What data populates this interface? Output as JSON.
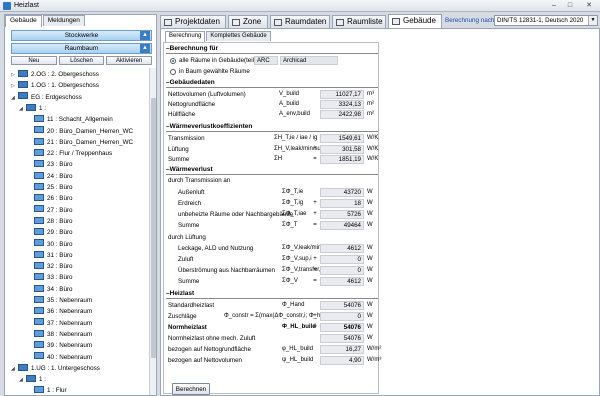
{
  "window": {
    "title": "Heizlast",
    "minimize": "–",
    "maximize": "□",
    "close": "✕"
  },
  "left": {
    "tabs": [
      "Gebäude",
      "Meldungen"
    ],
    "buttons": {
      "stockwerke": "Stockwerke",
      "raumbaum": "Raumbaum",
      "neu": "Neu",
      "loeschen": "Löschen",
      "aktivieren": "Aktivieren"
    },
    "tree": [
      {
        "label": "2.OG : 2. Obergeschoss",
        "tri": "▷",
        "level": 1,
        "type": "floor"
      },
      {
        "label": "1.OG : 1. Obergeschoss",
        "tri": "▷",
        "level": 1,
        "type": "floor"
      },
      {
        "label": "EG : Erdgeschoss",
        "tri": "◢",
        "level": 1,
        "type": "floor"
      },
      {
        "label": "1 :",
        "tri": "◢",
        "level": 2,
        "type": "floor"
      },
      {
        "label": "11 : Schacht_Allgemein",
        "tri": "",
        "level": 3,
        "type": "room"
      },
      {
        "label": "20 : Büro_Damen_Herren_WC",
        "tri": "",
        "level": 3,
        "type": "room"
      },
      {
        "label": "21 : Büro_Damen_Herren_WC",
        "tri": "",
        "level": 3,
        "type": "room"
      },
      {
        "label": "22 : Flur / Treppenhaus",
        "tri": "",
        "level": 3,
        "type": "room"
      },
      {
        "label": "23 : Büro",
        "tri": "",
        "level": 3,
        "type": "room"
      },
      {
        "label": "24 : Büro",
        "tri": "",
        "level": 3,
        "type": "room"
      },
      {
        "label": "25 : Büro",
        "tri": "",
        "level": 3,
        "type": "room"
      },
      {
        "label": "26 : Büro",
        "tri": "",
        "level": 3,
        "type": "room"
      },
      {
        "label": "27 : Büro",
        "tri": "",
        "level": 3,
        "type": "room"
      },
      {
        "label": "28 : Büro",
        "tri": "",
        "level": 3,
        "type": "room"
      },
      {
        "label": "29 : Büro",
        "tri": "",
        "level": 3,
        "type": "room"
      },
      {
        "label": "30 : Büro",
        "tri": "",
        "level": 3,
        "type": "room"
      },
      {
        "label": "31 : Büro",
        "tri": "",
        "level": 3,
        "type": "room"
      },
      {
        "label": "32 : Büro",
        "tri": "",
        "level": 3,
        "type": "room"
      },
      {
        "label": "33 : Büro",
        "tri": "",
        "level": 3,
        "type": "room"
      },
      {
        "label": "34 : Büro",
        "tri": "",
        "level": 3,
        "type": "room"
      },
      {
        "label": "35 : Nebenraum",
        "tri": "",
        "level": 3,
        "type": "room"
      },
      {
        "label": "36 : Nebenraum",
        "tri": "",
        "level": 3,
        "type": "room"
      },
      {
        "label": "37 : Nebenraum",
        "tri": "",
        "level": 3,
        "type": "room"
      },
      {
        "label": "38 : Nebenraum",
        "tri": "",
        "level": 3,
        "type": "room"
      },
      {
        "label": "39 : Nebenraum",
        "tri": "",
        "level": 3,
        "type": "room"
      },
      {
        "label": "40 : Nebenraum",
        "tri": "",
        "level": 3,
        "type": "room"
      },
      {
        "label": "1.UG : 1. Untergeschoss",
        "tri": "◢",
        "level": 1,
        "type": "floor"
      },
      {
        "label": "1 :",
        "tri": "◢",
        "level": 2,
        "type": "floor"
      },
      {
        "label": "1 : Flur",
        "tri": "",
        "level": 3,
        "type": "room"
      }
    ]
  },
  "main_tabs": [
    "Projektdaten",
    "Zone",
    "Raumdaten",
    "Raumliste",
    "Gebäude"
  ],
  "berechnung_label": "Berechnung nach",
  "berechnung_value": "DIN/TS 12831-1, Deutsch 2020",
  "sub_tabs": [
    "Berechnung",
    "Komplettes Gebäude"
  ],
  "sections": {
    "berechnung_fuer": "Berechnung für",
    "gebaeudedaten": "Gebäudedaten",
    "waermeverlustkoeff": "Wärmeverlustkoeffizienten",
    "waermeverlust": "Wärmeverlust",
    "heizlast": "Heizlast"
  },
  "radio": {
    "all_rooms": "alle Räume in Gebäude(teil)",
    "arc": "ARC",
    "archicad": "Archicad",
    "tree_rooms": "in Baum gewählte Räume"
  },
  "gebaeude": [
    {
      "label": "Nettovolumen (Luftvolumen)",
      "sym": "V_build",
      "value": "11027,17",
      "unit": "m³"
    },
    {
      "label": "Nettogrundfläche",
      "sym": "A_build",
      "value": "3324,13",
      "unit": "m²"
    },
    {
      "label": "Hüllfläche",
      "sym": "A_env,build",
      "value": "2422,98",
      "unit": "m²"
    }
  ],
  "koeff": [
    {
      "label": "Transmission",
      "sym": "ΣH_T,ie / iae / ig",
      "op": "",
      "value": "1549,61",
      "unit": "W/K"
    },
    {
      "label": "Lüftung",
      "sym": "ΣH_V,leak/min/sup/trans,i",
      "op": "+",
      "value": "301,58",
      "unit": "W/K"
    },
    {
      "label": "Summe",
      "sym": "ΣH",
      "op": "=",
      "value": "1851,19",
      "unit": "W/K"
    }
  ],
  "verlust": {
    "durch_transmission": "durch Transmission an",
    "transmission": [
      {
        "label": "Außenluft",
        "sym": "ΣΦ_T,ie",
        "op": "",
        "value": "43720",
        "unit": "W"
      },
      {
        "label": "Erdreich",
        "sym": "ΣΦ_T,ig",
        "op": "+",
        "value": "18",
        "unit": "W"
      },
      {
        "label": "unbeheizte Räume oder Nachbargebäude",
        "sym": "ΣΦ_T,iae",
        "op": "+",
        "value": "5726",
        "unit": "W"
      },
      {
        "label": "Summe",
        "sym": "ΣΦ_T",
        "op": "=",
        "value": "49464",
        "unit": "W"
      }
    ],
    "durch_lueftung": "durch Lüftung",
    "lueftung": [
      {
        "label": "Leckage, ALD und Nutzung",
        "sym": "ΣΦ_V,leak/min,i",
        "op": "",
        "value": "4612",
        "unit": "W"
      },
      {
        "label": "Zuluft",
        "sym": "ΣΦ_V,sup,i",
        "op": "+",
        "value": "0",
        "unit": "W"
      },
      {
        "label": "Überströmung aus Nachbarräumen",
        "sym": "ΣΦ_V,transfer,ij",
        "op": "+",
        "value": "0",
        "unit": "W"
      },
      {
        "label": "Summe",
        "sym": "ΣΦ_V",
        "op": "=",
        "value": "4612",
        "unit": "W"
      }
    ]
  },
  "heizlast": [
    {
      "label": "Standardheizlast",
      "sym": "Φ_Hand",
      "op": "",
      "value": "54076",
      "unit": "W",
      "bold": false
    },
    {
      "label": "Zuschläge",
      "sym": "Φ_constr = Σ(max(ΔΦ_constr,i; Φ_hu,i))",
      "op": "+",
      "value": "0",
      "unit": "W",
      "bold": false
    },
    {
      "label": "Normheizlast",
      "sym": "Φ_HL_build",
      "op": "=",
      "value": "54076",
      "unit": "W",
      "bold": true
    },
    {
      "label": "Normheizlast ohne mech. Zuluft",
      "sym": "",
      "op": "",
      "value": "54076",
      "unit": "W",
      "bold": false
    },
    {
      "label": "bezogen auf Nettogrundfläche",
      "sym": "φ_HL_build",
      "op": "",
      "value": "16,27",
      "unit": "W/m²",
      "bold": false
    },
    {
      "label": "bezogen auf Nettovolumen",
      "sym": "ψ_HL_build",
      "op": "",
      "value": "4,90",
      "unit": "W/m³",
      "bold": false
    }
  ],
  "calc_button": "Berechnen"
}
